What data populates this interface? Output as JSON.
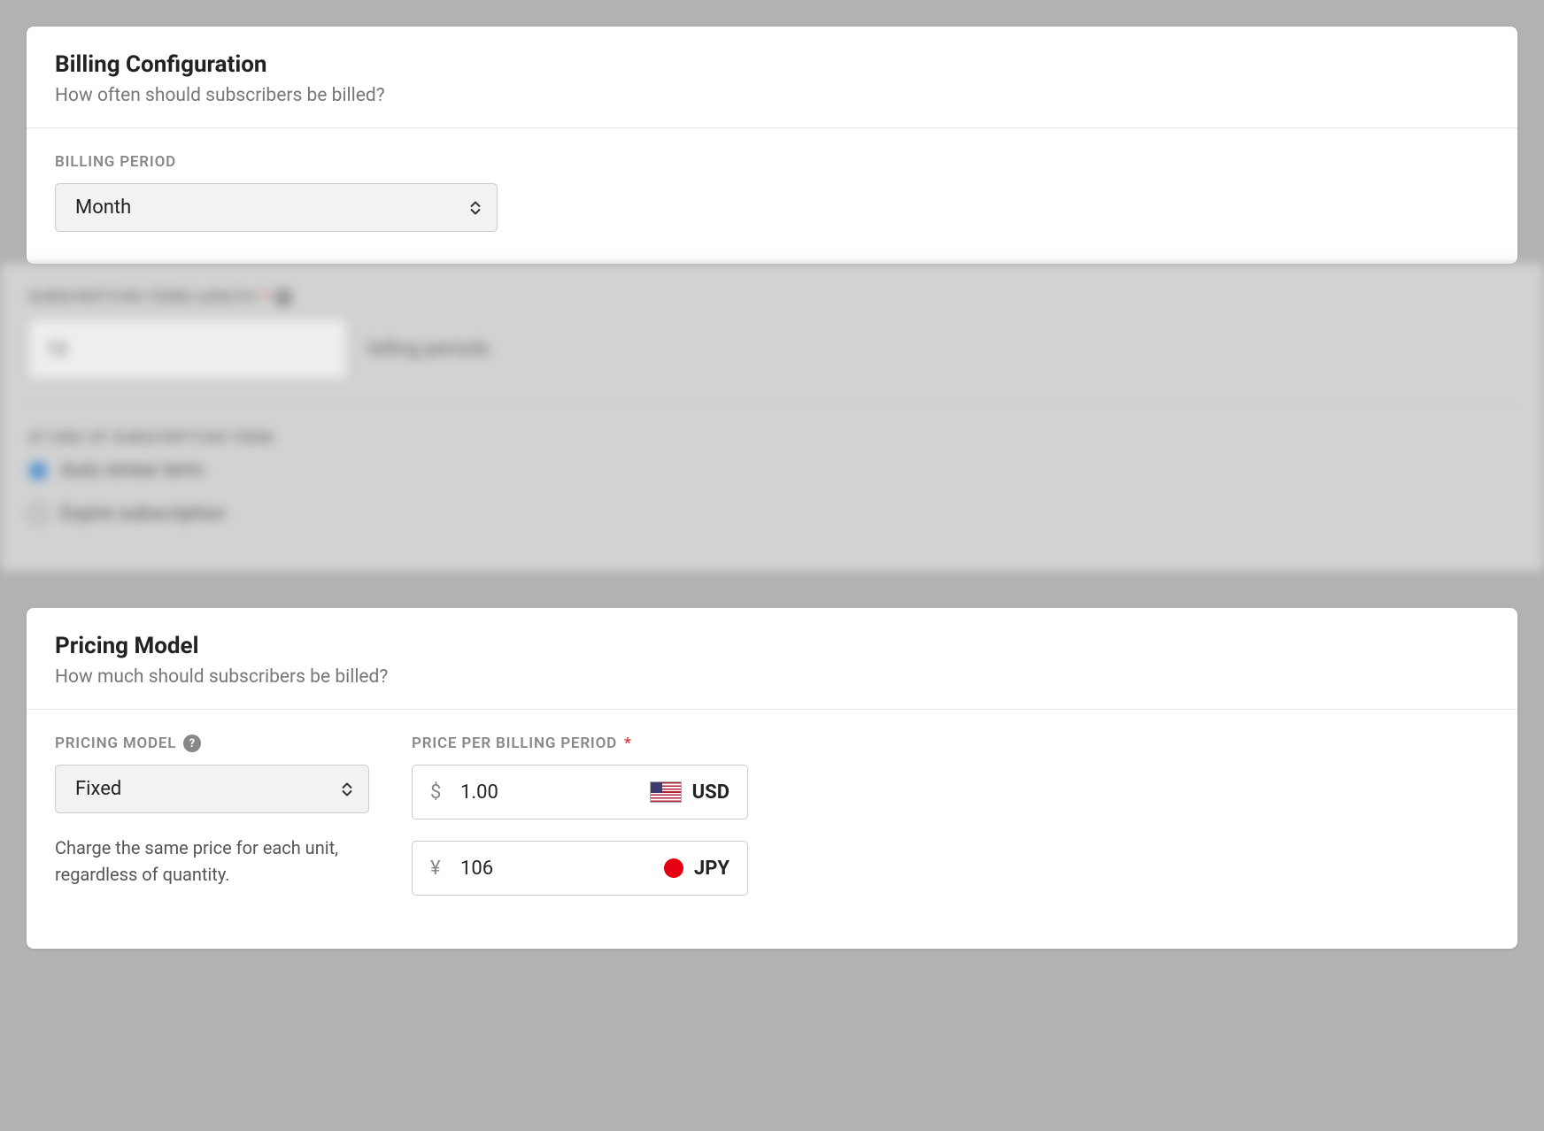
{
  "billing": {
    "title": "Billing Configuration",
    "subtitle": "How often should subscribers be billed?",
    "period_label": "BILLING PERIOD",
    "period_value": "Month"
  },
  "blurred": {
    "term_label": "SUBSCRIPTION TERM LENGTH",
    "term_value": "12",
    "term_suffix": "billing periods",
    "end_label": "AT END OF SUBSCRIPTION TERM",
    "radio1": "Auto renew term",
    "radio2": "Expire subscription"
  },
  "pricing": {
    "title": "Pricing Model",
    "subtitle": "How much should subscribers be billed?",
    "model_label": "PRICING MODEL",
    "model_value": "Fixed",
    "hint": "Charge the same price for each unit, regardless of quantity.",
    "price_label": "PRICE PER BILLING PERIOD",
    "rows": [
      {
        "symbol": "$",
        "value": "1.00",
        "code": "USD"
      },
      {
        "symbol": "¥",
        "value": "106",
        "code": "JPY"
      }
    ]
  }
}
